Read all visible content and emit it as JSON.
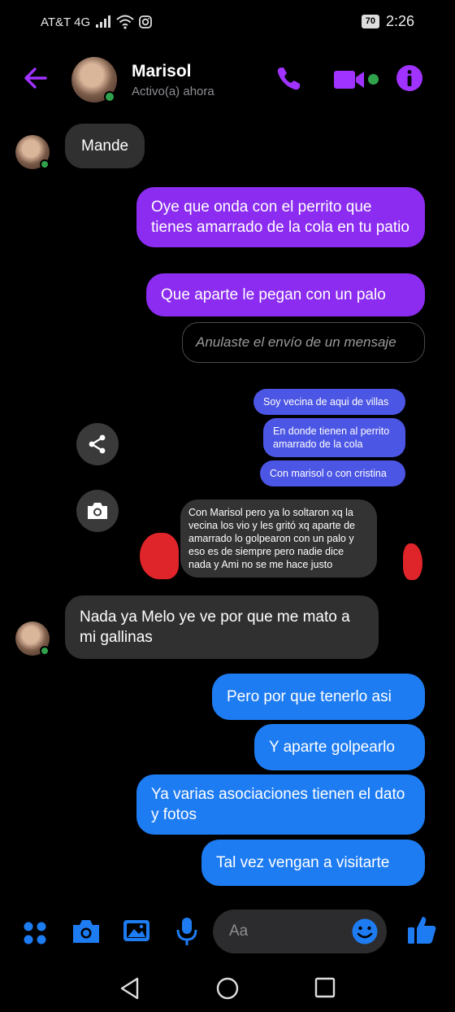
{
  "status_bar": {
    "carrier": "AT&T 4G",
    "battery": "70",
    "time": "2:26"
  },
  "header": {
    "contact_name": "Marisol",
    "contact_status": "Activo(a) ahora"
  },
  "colors": {
    "accent": "#a033ff",
    "sent_purple": "#8b2cf0",
    "sent_blue": "#1e7cf2",
    "received": "#303030",
    "online": "#31a24c"
  },
  "messages": [
    {
      "from": "contact",
      "text": "Mande"
    },
    {
      "from": "me",
      "text": "Oye que onda con el perrito que tienes amarrado de la cola en tu patio"
    },
    {
      "from": "me",
      "text": "Que aparte le pegan con un palo"
    },
    {
      "from": "me",
      "text": "Anulaste el envío de un mensaje",
      "unsent": true
    },
    {
      "from": "shared",
      "text": "Soy vecina de aqui de villas"
    },
    {
      "from": "shared",
      "text": "En donde tienen al perrito amarrado de la cola"
    },
    {
      "from": "shared",
      "text": "Con marisol o con cristina"
    },
    {
      "from": "shared-contact",
      "text": "Con Marisol pero ya lo soltaron xq la vecina los vio y les gritó xq aparte de amarrado lo golpearon con un palo y eso es de siempre pero nadie dice nada y Ami no se me hace justo"
    },
    {
      "from": "contact",
      "text": "Nada ya Melo ye ve por que me mato a mi gallinas"
    },
    {
      "from": "me",
      "text": "Pero por que tenerlo asi"
    },
    {
      "from": "me",
      "text": "Y aparte golpearlo"
    },
    {
      "from": "me",
      "text": "Ya varias asociaciones tienen el dato y fotos"
    },
    {
      "from": "me",
      "text": "Tal vez vengan a visitarte"
    }
  ],
  "composer": {
    "placeholder": "Aa"
  },
  "icons": {
    "back": "arrow-left-icon",
    "call": "phone-icon",
    "video": "video-camera-icon",
    "info": "info-icon",
    "share": "share-icon",
    "camera": "camera-icon",
    "apps": "grid-icon",
    "photo": "image-icon",
    "mic": "microphone-icon",
    "emoji": "emoji-icon",
    "like": "thumbs-up-icon"
  }
}
